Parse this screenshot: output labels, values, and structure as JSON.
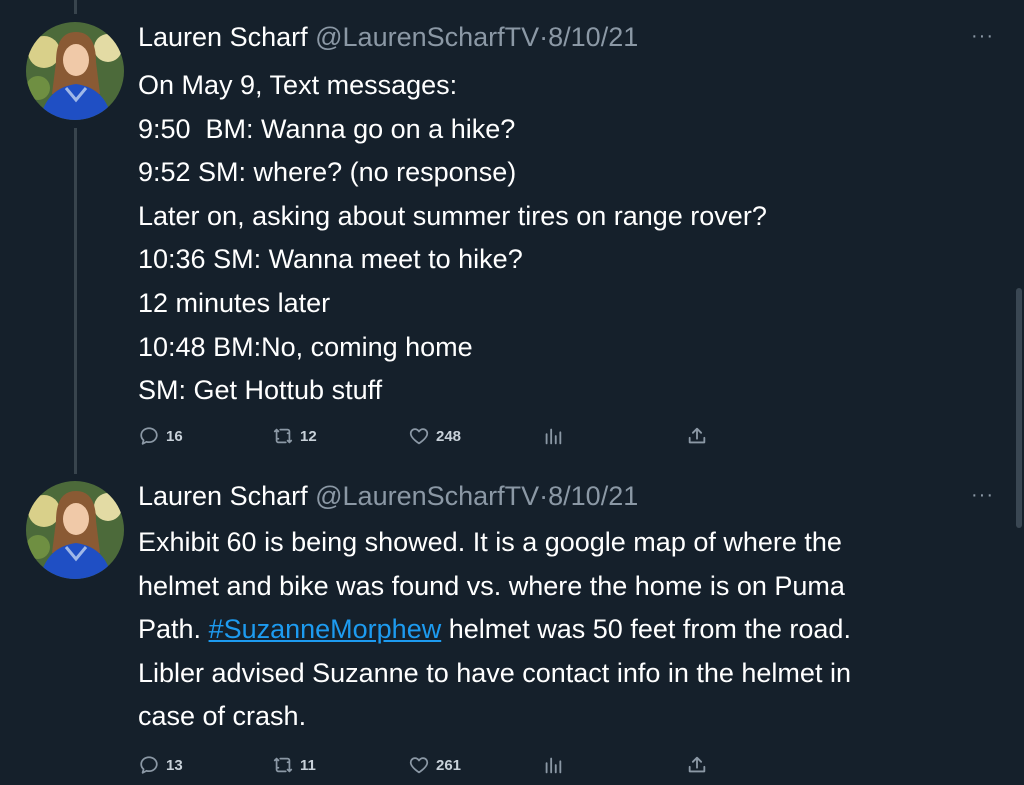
{
  "tweets": [
    {
      "author": {
        "name": "Lauren Scharf",
        "handle": "@LaurenScharfTV",
        "separator": "·",
        "date": "8/10/21"
      },
      "more_label": "···",
      "lines": [
        "On May 9, Text messages:",
        "9:50  BM: Wanna go on a hike?",
        "9:52 SM: where? (no response)",
        "Later on, asking about summer tires on range rover?",
        "10:36 SM: Wanna meet to hike?",
        "12 minutes later",
        "10:48 BM:No, coming home",
        "SM: Get Hottub stuff"
      ],
      "stats": {
        "replies": "16",
        "retweets": "12",
        "likes": "248"
      }
    },
    {
      "author": {
        "name": "Lauren Scharf",
        "handle": "@LaurenScharfTV",
        "separator": "·",
        "date": "8/10/21"
      },
      "more_label": "···",
      "lines": [
        "Exhibit 60 is being showed. It is a google map of where the",
        "helmet and bike was found vs. where the home is on Puma",
        "Path.",
        "#SuzanneMorphew",
        "helmet was 50 feet from the road.",
        "Libler advised Suzanne to have contact info in the helmet in",
        "case of crash."
      ],
      "stats": {
        "replies": "13",
        "retweets": "11",
        "likes": "261"
      }
    }
  ],
  "icons": {
    "reply": "reply-icon",
    "retweet": "retweet-icon",
    "like": "heart-icon",
    "views": "bar-chart-icon",
    "share": "share-icon",
    "more": "more-icon"
  },
  "colors": {
    "background": "#15202b",
    "text": "#ffffff",
    "secondary": "#8b98a5",
    "link": "#1d9bf0",
    "thread_line": "#38444d"
  }
}
